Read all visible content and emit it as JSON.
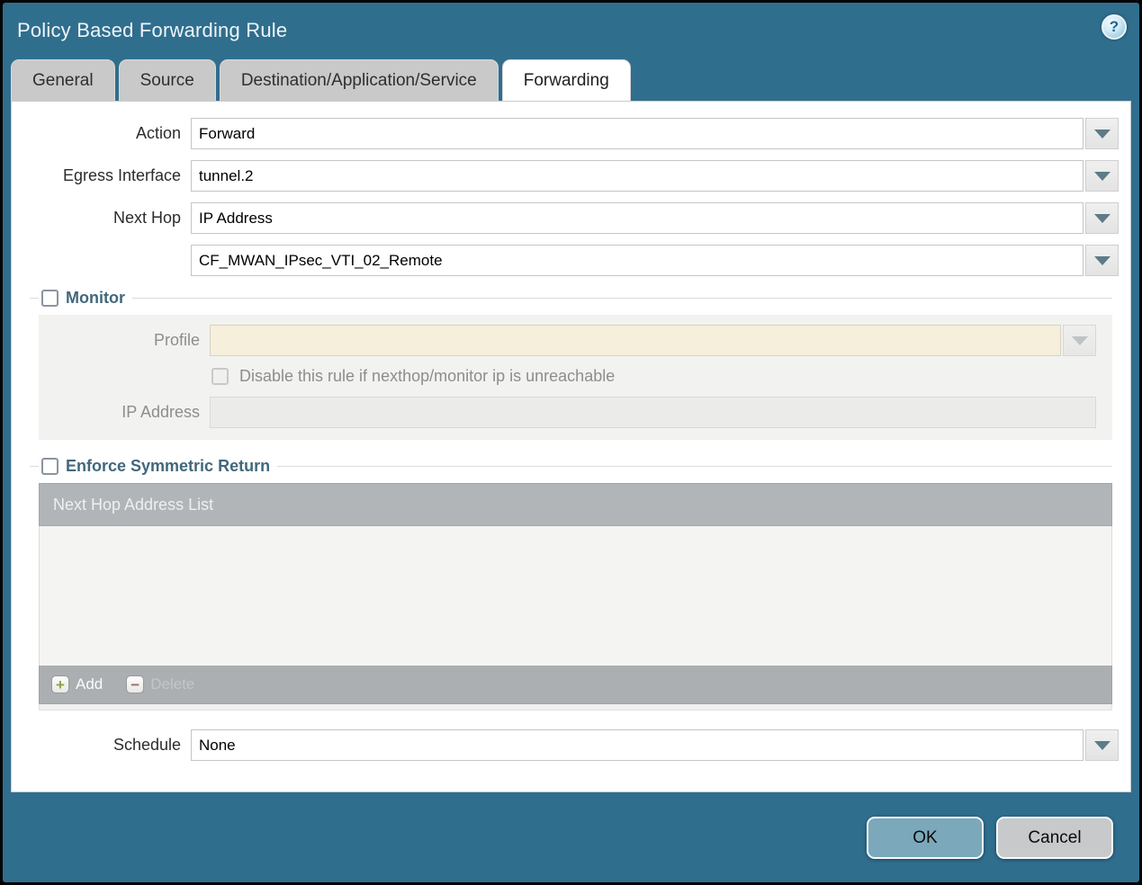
{
  "window": {
    "title": "Policy Based Forwarding Rule"
  },
  "icons": {
    "help": "?",
    "add": "+",
    "delete": "−"
  },
  "tabs": [
    {
      "label": "General",
      "active": false
    },
    {
      "label": "Source",
      "active": false
    },
    {
      "label": "Destination/Application/Service",
      "active": false
    },
    {
      "label": "Forwarding",
      "active": true
    }
  ],
  "form": {
    "action": {
      "label": "Action",
      "value": "Forward"
    },
    "egress_interface": {
      "label": "Egress Interface",
      "value": "tunnel.2"
    },
    "next_hop": {
      "label": "Next Hop",
      "value": "IP Address"
    },
    "next_hop_address": {
      "value": "CF_MWAN_IPsec_VTI_02_Remote"
    },
    "schedule": {
      "label": "Schedule",
      "value": "None"
    }
  },
  "monitor": {
    "title": "Monitor",
    "checked": false,
    "profile_label": "Profile",
    "profile_value": "",
    "disable_label": "Disable this rule if nexthop/monitor ip is unreachable",
    "disable_checked": false,
    "ip_address_label": "IP Address",
    "ip_address_value": ""
  },
  "enforce": {
    "title": "Enforce Symmetric Return",
    "checked": false,
    "table_header": "Next Hop Address List",
    "rows": [],
    "add_label": "Add",
    "delete_label": "Delete",
    "delete_enabled": false
  },
  "footer": {
    "ok_label": "OK",
    "cancel_label": "Cancel"
  },
  "colors": {
    "teal": "#306e8e",
    "heading": "#41687c",
    "profile_field": "#f5efdb"
  }
}
